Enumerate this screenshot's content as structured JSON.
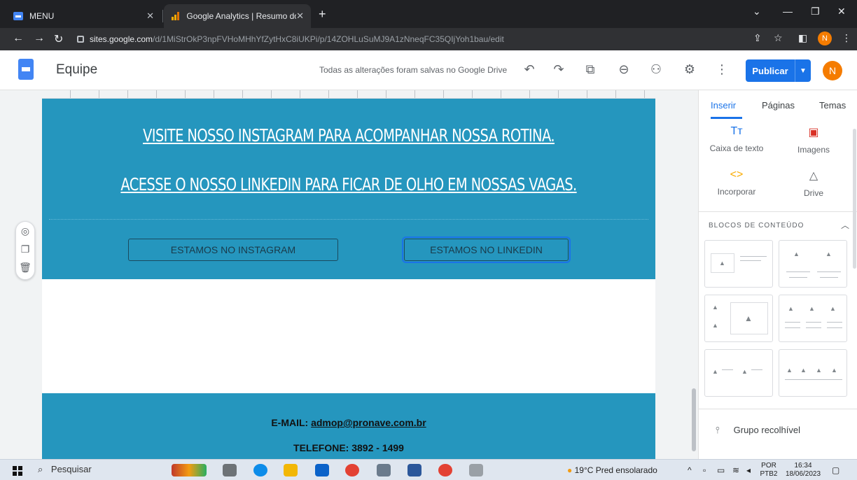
{
  "browser": {
    "tabs": [
      {
        "title": "MENU",
        "active": false
      },
      {
        "title": "Google Analytics | Resumo dos r",
        "active": true
      }
    ],
    "url_host": "sites.google.com",
    "url_path": "/d/1MiStrOkP3npFVHoMHhYfZytHxC8iUKPi/p/14ZOHLuSuMJ9A1zNneqFC35QIjYoh1bau/edit",
    "profile_initial": "N"
  },
  "sites_header": {
    "site_title": "Equipe",
    "saved_message": "Todas as alterações foram salvas no Google Drive",
    "publish_label": "Publicar",
    "avatar_initial": "N"
  },
  "page": {
    "line1": "VISITE NOSSO INSTAGRAM PARA ACOMPANHAR NOSSA ROTINA.",
    "line2": "ACESSE O NOSSO LINKEDIN PARA FICAR DE OLHO EM NOSSAS VAGAS.",
    "button_instagram": "ESTAMOS NO INSTAGRAM",
    "button_linkedin": "ESTAMOS NO LINKEDIN",
    "email_label": "E-MAIL: ",
    "email_value": "admop@pronave.com.br",
    "phone": "TELEFONE: 3892 - 1499"
  },
  "panel": {
    "tabs": [
      "Inserir",
      "Páginas",
      "Temas"
    ],
    "items": [
      {
        "label": "Caixa de texto",
        "icon": "text-box-icon"
      },
      {
        "label": "Imagens",
        "icon": "image-icon"
      },
      {
        "label": "Incorporar",
        "icon": "embed-icon"
      },
      {
        "label": "Drive",
        "icon": "drive-icon"
      }
    ],
    "blocks_title": "BLOCOS DE CONTEÚDO",
    "collapsible_label": "Grupo recolhível"
  },
  "taskbar": {
    "search_placeholder": "Pesquisar",
    "weather": "19°C  Pred ensolarado",
    "language_top": "POR",
    "language_bottom": "PTB2",
    "time": "16:34",
    "date": "18/06/2023"
  },
  "colors": {
    "teal": "#2596be",
    "publish_blue": "#1a73e8",
    "avatar_orange": "#f57c00"
  }
}
